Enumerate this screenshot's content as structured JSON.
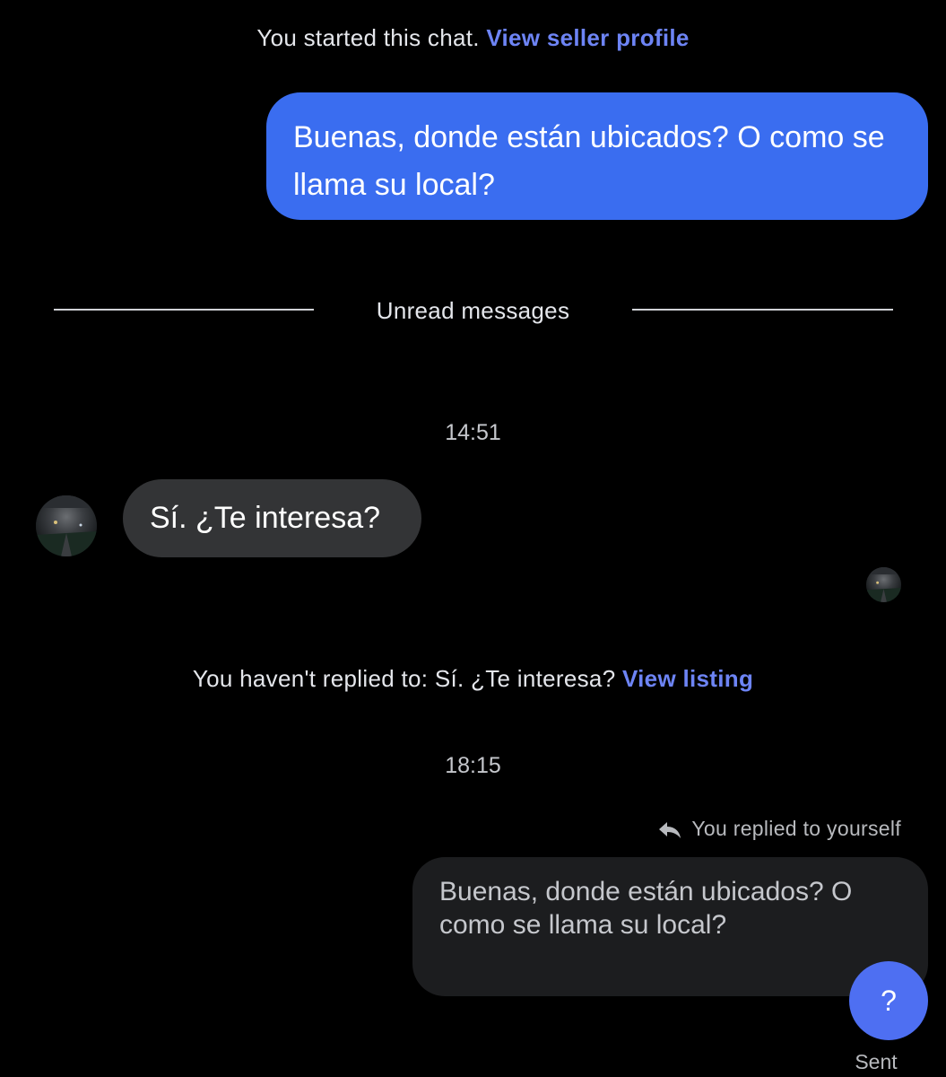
{
  "header": {
    "chat_started_text": "You started this chat.",
    "view_seller_profile_link": "View seller profile"
  },
  "messages": [
    {
      "direction": "outgoing",
      "text": "Buenas, donde están ubicados? O como se llama su local?"
    },
    {
      "direction": "incoming",
      "time": "14:51",
      "text": "Sí. ¿Te interesa?"
    },
    {
      "direction": "outgoing",
      "time": "18:15",
      "reply_context": "You replied to yourself",
      "text": "Buenas, donde están ubicados? O como se llama su local?",
      "status": "Sent"
    }
  ],
  "divider": {
    "label": "Unread messages"
  },
  "not_replied": {
    "text": "You haven't replied to: Sí. ¿Te interesa?",
    "view_listing_link": "View listing"
  },
  "help_button": {
    "label": "?"
  },
  "icons": {
    "reply": "reply-arrow-icon",
    "avatar": "seller-avatar"
  },
  "colors": {
    "background": "#000000",
    "outgoing_bubble": "#3a6df0",
    "incoming_bubble": "#333436",
    "reply_bubble": "#1c1d1f",
    "link": "#6d84f5",
    "help_button": "#4e6ff2"
  }
}
